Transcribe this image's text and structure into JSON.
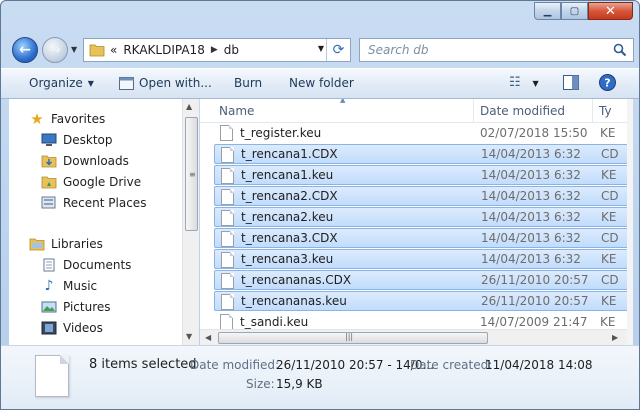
{
  "address": {
    "overflow": "«",
    "crumbs": [
      "RKAKLDIPA18",
      "db"
    ]
  },
  "search": {
    "placeholder": "Search db"
  },
  "toolbar": {
    "organize": "Organize",
    "open_with": "Open with...",
    "burn": "Burn",
    "new_folder": "New folder"
  },
  "sidebar": {
    "favorites_label": "Favorites",
    "favorites": [
      "Desktop",
      "Downloads",
      "Google Drive",
      "Recent Places"
    ],
    "libraries_label": "Libraries",
    "libraries": [
      "Documents",
      "Music",
      "Pictures",
      "Videos"
    ]
  },
  "columns": {
    "name": "Name",
    "date": "Date modified",
    "type": "Ty"
  },
  "files": [
    {
      "name": "t_register.keu",
      "date": "02/07/2018 15:50",
      "type": "KE",
      "selected": false
    },
    {
      "name": "t_rencana1.CDX",
      "date": "14/04/2013 6:32",
      "type": "CD",
      "selected": true
    },
    {
      "name": "t_rencana1.keu",
      "date": "14/04/2013 6:32",
      "type": "KE",
      "selected": true
    },
    {
      "name": "t_rencana2.CDX",
      "date": "14/04/2013 6:32",
      "type": "CD",
      "selected": true
    },
    {
      "name": "t_rencana2.keu",
      "date": "14/04/2013 6:32",
      "type": "KE",
      "selected": true
    },
    {
      "name": "t_rencana3.CDX",
      "date": "14/04/2013 6:32",
      "type": "CD",
      "selected": true
    },
    {
      "name": "t_rencana3.keu",
      "date": "14/04/2013 6:32",
      "type": "KE",
      "selected": true
    },
    {
      "name": "t_rencananas.CDX",
      "date": "26/11/2010 20:57",
      "type": "CD",
      "selected": true
    },
    {
      "name": "t_rencananas.keu",
      "date": "26/11/2010 20:57",
      "type": "KE",
      "selected": true
    },
    {
      "name": "t_sandi.keu",
      "date": "14/07/2009 21:47",
      "type": "KE",
      "selected": false
    }
  ],
  "details": {
    "selection": "8 items selected",
    "date_modified_label": "Date modified:",
    "date_modified_value": "26/11/2010 20:57 - 14/0...",
    "date_created_label": "Date created:",
    "date_created_value": "11/04/2018 14:08",
    "size_label": "Size:",
    "size_value": "15,9 KB"
  },
  "colors": {
    "selection_bg": "#c9e0fb",
    "selection_border": "#8ab4e8",
    "chrome": "#bcd3ee",
    "close": "#c63a1c"
  }
}
